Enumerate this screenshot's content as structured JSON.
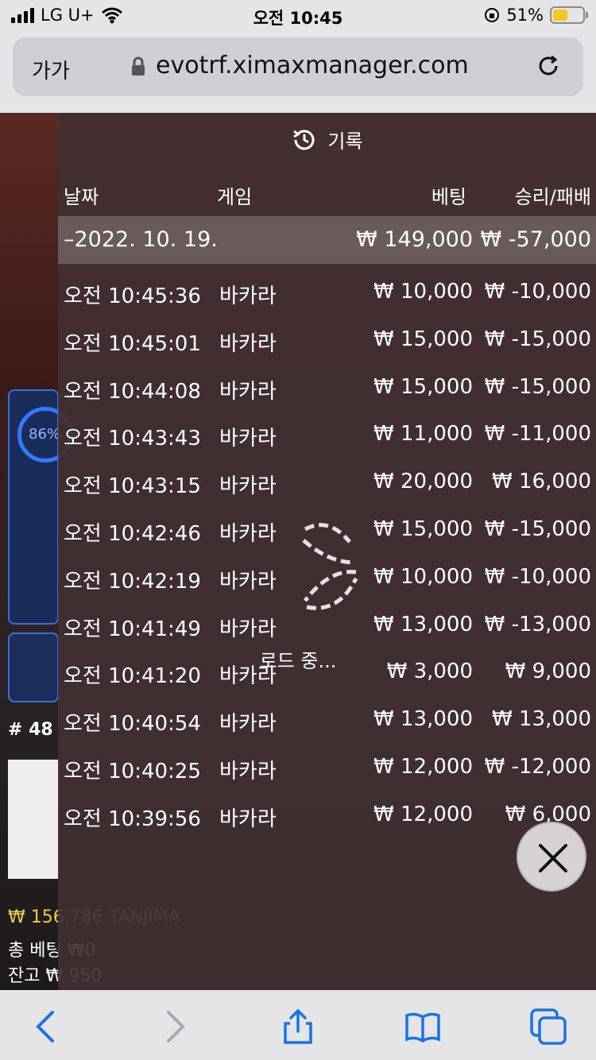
{
  "status_bar": {
    "carrier": "LG U+",
    "time": "오전 10:45",
    "battery_percent": "51%",
    "battery_level": 0.51
  },
  "browser": {
    "aa_label": "가가",
    "url": "evotrf.ximaxmanager.com",
    "icons": [
      "lock-icon",
      "reload-icon",
      "back-icon",
      "forward-icon",
      "share-icon",
      "bookmarks-icon",
      "tabs-icon"
    ]
  },
  "background": {
    "progress_text": "86%",
    "hash_label": "# 48",
    "balance_line": "₩ 156,786 TANJIMA",
    "total_bet": "총 베팅 ₩0",
    "remaining": "잔고 ₩ 950"
  },
  "history": {
    "title": "기록",
    "headers": {
      "date": "날짜",
      "game": "게임",
      "bet": "베팅",
      "result": "승리/패배"
    },
    "day": {
      "date": "–2022. 10. 19.",
      "bet": "₩ 149,000",
      "result": "₩ -57,000"
    },
    "rows": [
      {
        "time": "오전 10:45:36",
        "game": "바카라",
        "bet": "₩ 10,000",
        "result": "₩ -10,000"
      },
      {
        "time": "오전 10:45:01",
        "game": "바카라",
        "bet": "₩ 15,000",
        "result": "₩ -15,000"
      },
      {
        "time": "오전 10:44:08",
        "game": "바카라",
        "bet": "₩ 15,000",
        "result": "₩ -15,000"
      },
      {
        "time": "오전 10:43:43",
        "game": "바카라",
        "bet": "₩ 11,000",
        "result": "₩ -11,000"
      },
      {
        "time": "오전 10:43:15",
        "game": "바카라",
        "bet": "₩ 20,000",
        "result": "₩ 16,000"
      },
      {
        "time": "오전 10:42:46",
        "game": "바카라",
        "bet": "₩ 15,000",
        "result": "₩ -15,000"
      },
      {
        "time": "오전 10:42:19",
        "game": "바카라",
        "bet": "₩ 10,000",
        "result": "₩ -10,000"
      },
      {
        "time": "오전 10:41:49",
        "game": "바카라",
        "bet": "₩ 13,000",
        "result": "₩ -13,000"
      },
      {
        "time": "오전 10:41:20",
        "game": "바카라",
        "bet": "₩ 3,000",
        "result": "₩ 9,000"
      },
      {
        "time": "오전 10:40:54",
        "game": "바카라",
        "bet": "₩ 13,000",
        "result": "₩ 13,000"
      },
      {
        "time": "오전 10:40:25",
        "game": "바카라",
        "bet": "₩ 12,000",
        "result": "₩ -12,000"
      },
      {
        "time": "오전 10:39:56",
        "game": "바카라",
        "bet": "₩ 12,000",
        "result": "₩ 6,000"
      }
    ],
    "loading_text": "로드 중..."
  }
}
